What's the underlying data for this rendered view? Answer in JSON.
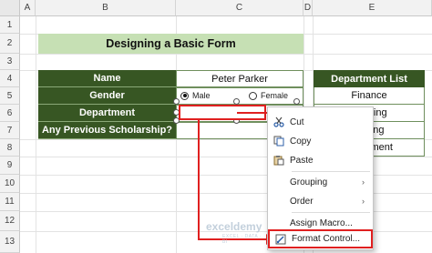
{
  "columns": [
    "A",
    "B",
    "C",
    "D",
    "E"
  ],
  "rows": [
    "1",
    "2",
    "3",
    "4",
    "5",
    "6",
    "7",
    "8",
    "9",
    "10",
    "11",
    "12",
    "13"
  ],
  "title": "Designing a Basic Form",
  "form": {
    "name_label": "Name",
    "name_value": "Peter Parker",
    "gender_label": "Gender",
    "gender_options": [
      "Male",
      "Female"
    ],
    "gender_selected": "Male",
    "department_label": "Department",
    "department_value": "",
    "scholarship_label": "Any Previous Scholarship?",
    "scholarship_value": ""
  },
  "department_list": {
    "header": "Department List",
    "items": [
      "Finance",
      "...unting",
      "...eting",
      "...agement"
    ]
  },
  "context_menu": {
    "items": [
      {
        "label": "Cut",
        "icon": "scissors-icon"
      },
      {
        "label": "Copy",
        "icon": "copy-icon"
      },
      {
        "label": "Paste",
        "icon": "paste-icon"
      },
      {
        "label": "Grouping",
        "icon": "",
        "submenu": true
      },
      {
        "label": "Order",
        "icon": "",
        "submenu": true
      },
      {
        "label": "Assign Macro...",
        "icon": ""
      },
      {
        "label": "Format Control...",
        "icon": "format-control-icon",
        "highlighted": true
      }
    ]
  },
  "watermark": {
    "text": "exceldemy",
    "sub": "EXCEL · DATA · BI"
  },
  "colors": {
    "dark_green": "#375623",
    "light_green": "#c6e0b4",
    "highlight_red": "#e02020"
  }
}
